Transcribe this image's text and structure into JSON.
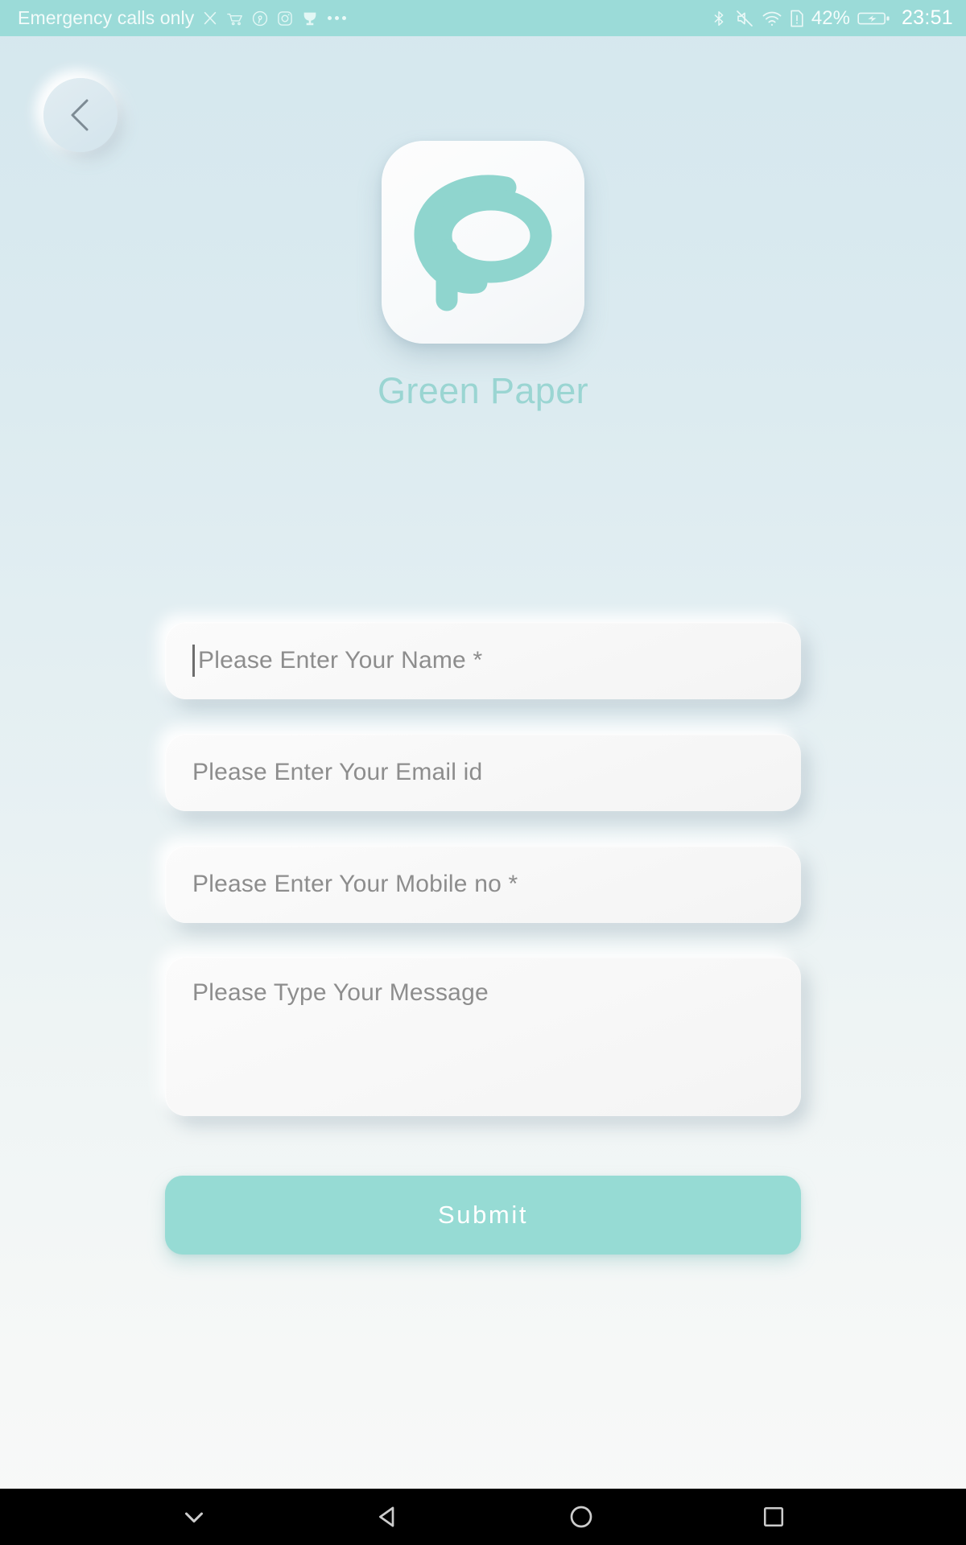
{
  "status_bar": {
    "carrier_text": "Emergency calls only",
    "notification_icons": [
      "scissors-icon",
      "shopping-cart-icon",
      "pinterest-icon",
      "instagram-icon",
      "trophy-icon",
      "more-dots-icon"
    ],
    "system_icons": [
      "bluetooth-icon",
      "volume-mute-icon",
      "wifi-icon",
      "sim-alert-icon"
    ],
    "battery_percent": "42%",
    "battery_state_icon": "battery-charging-icon",
    "time": "23:51",
    "background_color": "#9bdbd8",
    "text_color": "#ffffff"
  },
  "header": {
    "back_button_icon": "chevron-left-icon",
    "logo_icon": "green-paper-gp-monogram-icon",
    "app_title": "Green Paper",
    "app_title_color": "#9ad5d2",
    "logo_mark_color": "#8fd5ce",
    "logo_tile_color": "#fbfbfb"
  },
  "form": {
    "fields": [
      {
        "name": "name",
        "placeholder": "Please Enter Your Name *",
        "value": "",
        "type": "text",
        "focused": true
      },
      {
        "name": "email",
        "placeholder": "Please Enter Your Email id",
        "value": "",
        "type": "email",
        "focused": false
      },
      {
        "name": "mobile",
        "placeholder": "Please Enter Your Mobile no *",
        "value": "",
        "type": "tel",
        "focused": false
      },
      {
        "name": "message",
        "placeholder": "Please Type Your Message",
        "value": "",
        "type": "textarea",
        "focused": false
      }
    ],
    "submit_label": "Submit",
    "submit_color": "#96dbd4",
    "placeholder_color": "#8d8d8d"
  },
  "nav_bar": {
    "buttons": [
      "hide-keyboard-icon",
      "back-triangle-icon",
      "home-circle-icon",
      "recents-square-icon"
    ],
    "background_color": "#000000"
  },
  "theme": {
    "accent": "#96dbd4",
    "background_top": "#d5e7ee",
    "background_bottom": "#f8f9f8"
  }
}
